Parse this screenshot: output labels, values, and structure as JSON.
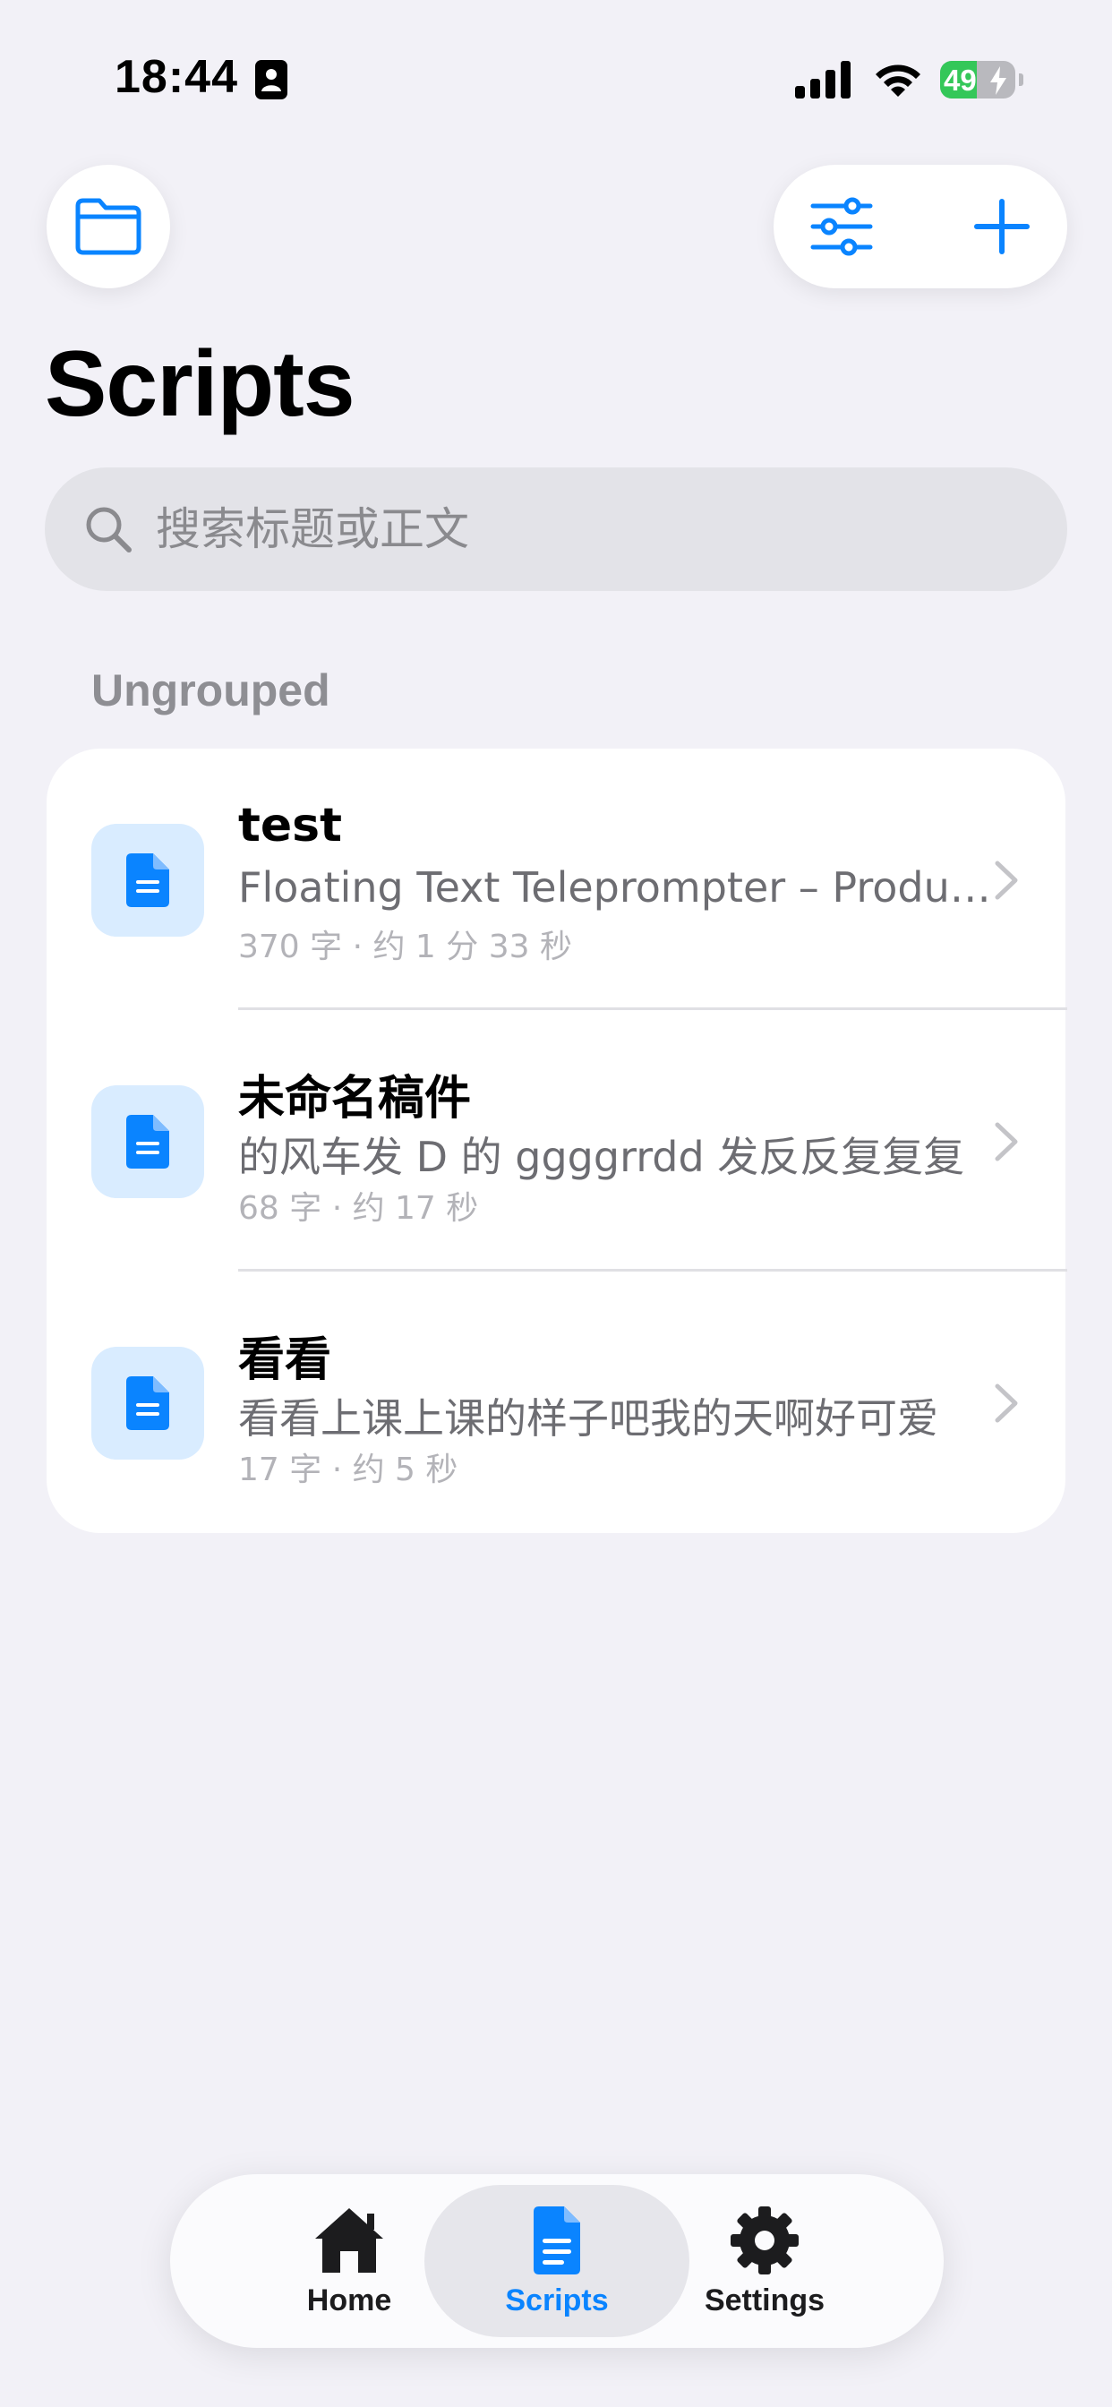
{
  "status_bar": {
    "time": "18:44",
    "battery_percent": "49"
  },
  "header": {
    "title": "Scripts"
  },
  "search": {
    "placeholder": "搜索标题或正文"
  },
  "section": {
    "title": "Ungrouped"
  },
  "scripts": [
    {
      "title": "test",
      "preview": "Floating Text Teleprompter – Productivity Tool",
      "meta": "370 字 · 约 1 分 33 秒"
    },
    {
      "title": "未命名稿件",
      "preview": "的风车发 D 的 ggggrrdd 发反反复复复",
      "meta": "68 字 · 约 17 秒"
    },
    {
      "title": "看看",
      "preview": "看看上课上课的样子吧我的天啊好可爱",
      "meta": "17 字 · 约 5 秒"
    }
  ],
  "tab_bar": {
    "tabs": [
      {
        "label": "Home",
        "icon": "house-icon",
        "active": false
      },
      {
        "label": "Scripts",
        "icon": "document-icon",
        "active": true
      },
      {
        "label": "Settings",
        "icon": "gear-icon",
        "active": false
      }
    ]
  },
  "colors": {
    "accent": "#0a84ff",
    "background": "#f2f1f7",
    "battery_green": "#34c759"
  }
}
